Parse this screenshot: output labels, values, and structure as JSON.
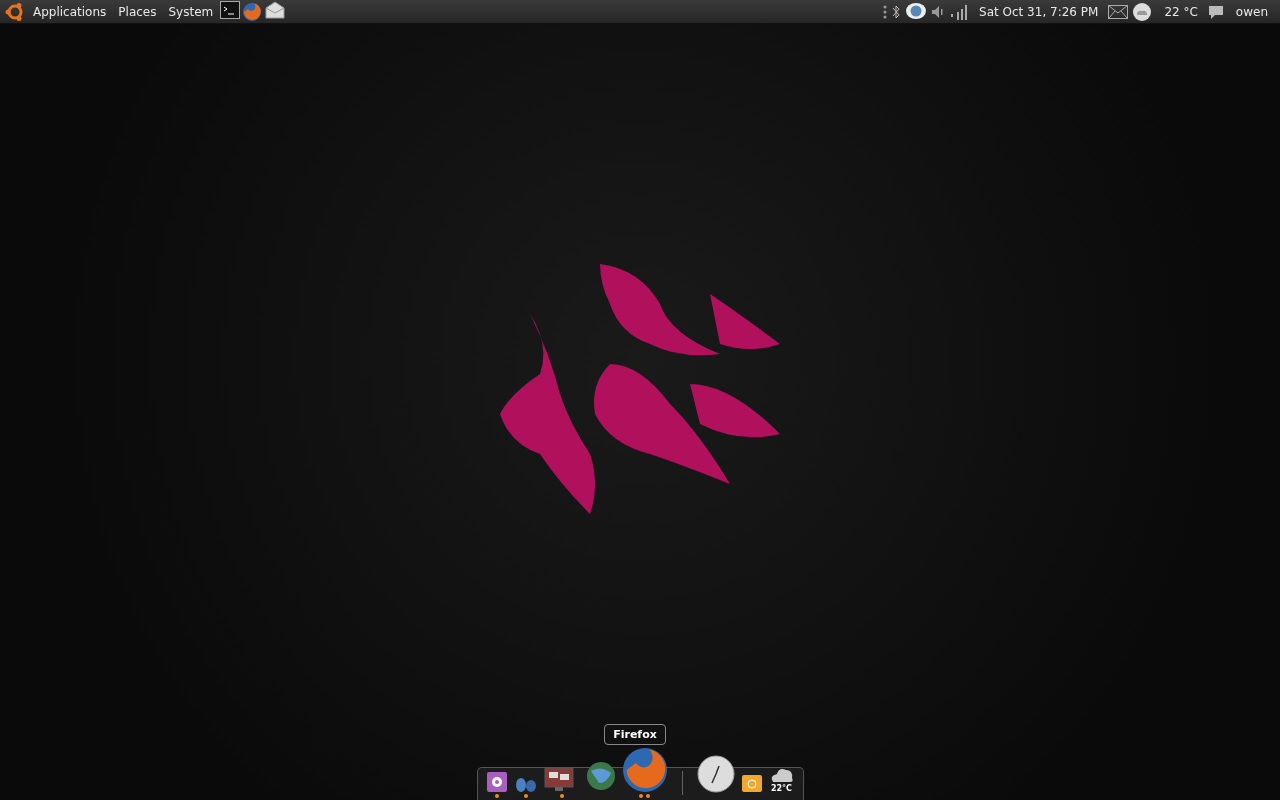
{
  "top_panel": {
    "menus": [
      {
        "label": "Applications"
      },
      {
        "label": "Places"
      },
      {
        "label": "System"
      }
    ],
    "launchers": [
      {
        "kind": "terminal"
      },
      {
        "kind": "browser"
      },
      {
        "kind": "mail"
      }
    ],
    "clock": "Sat Oct 31,  7:26 PM",
    "weather": "22 °C",
    "user": "owen"
  },
  "dock": {
    "tooltip": "Firefox",
    "items": [
      {
        "kind": "settings",
        "running": true
      },
      {
        "kind": "footprints",
        "running": true
      },
      {
        "kind": "monitor",
        "running": true
      },
      {
        "kind": "globe",
        "running": false
      },
      {
        "kind": "browser",
        "running": true
      },
      {
        "kind": "separator"
      },
      {
        "kind": "clock",
        "running": false
      },
      {
        "kind": "folder",
        "running": false
      },
      {
        "kind": "weather",
        "running": false,
        "label": "22°C"
      }
    ]
  }
}
